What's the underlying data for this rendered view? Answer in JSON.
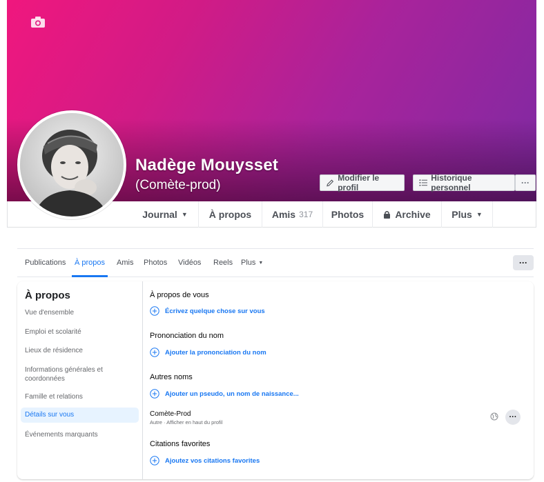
{
  "profile": {
    "name": "Nadège Mouysset",
    "alternate_name": "(Comète-prod)"
  },
  "cover_actions": {
    "edit_profile": "Modifier le profil",
    "activity_log": "Historique personnel",
    "more": "···"
  },
  "timeline_nav": {
    "journal": "Journal",
    "about": "À propos",
    "friends": "Amis",
    "friends_count": "317",
    "photos": "Photos",
    "archive": "Archive",
    "more": "Plus"
  },
  "subtabs": {
    "items": [
      "Publications",
      "À propos",
      "Amis",
      "Photos",
      "Vidéos",
      "Reels",
      "Plus"
    ],
    "active": "À propos",
    "more_button": "···"
  },
  "about": {
    "title": "À propos",
    "sidebar": [
      "Vue d'ensemble",
      "Emploi et scolarité",
      "Lieux de résidence",
      "Informations générales et coordonnées",
      "Famille et relations",
      "Détails sur vous",
      "Événements marquants"
    ],
    "active_item": "Détails sur vous",
    "sections": {
      "about_you": {
        "title": "À propos de vous",
        "add": "Écrivez quelque chose sur vous"
      },
      "pronunciation": {
        "title": "Prononciation du nom",
        "add": "Ajouter la prononciation du nom"
      },
      "other_names": {
        "title": "Autres noms",
        "add": "Ajouter un pseudo, un nom de naissance...",
        "entry_name": "Comète-Prod",
        "entry_sub": "Autre · Afficher en haut du profil",
        "entry_more": "···"
      },
      "quotes": {
        "title": "Citations favorites",
        "add": "Ajoutez vos citations favorites"
      }
    }
  },
  "colors": {
    "accent": "#1877f2",
    "cover_start": "#f0177e",
    "cover_end": "#7e2aa3"
  }
}
